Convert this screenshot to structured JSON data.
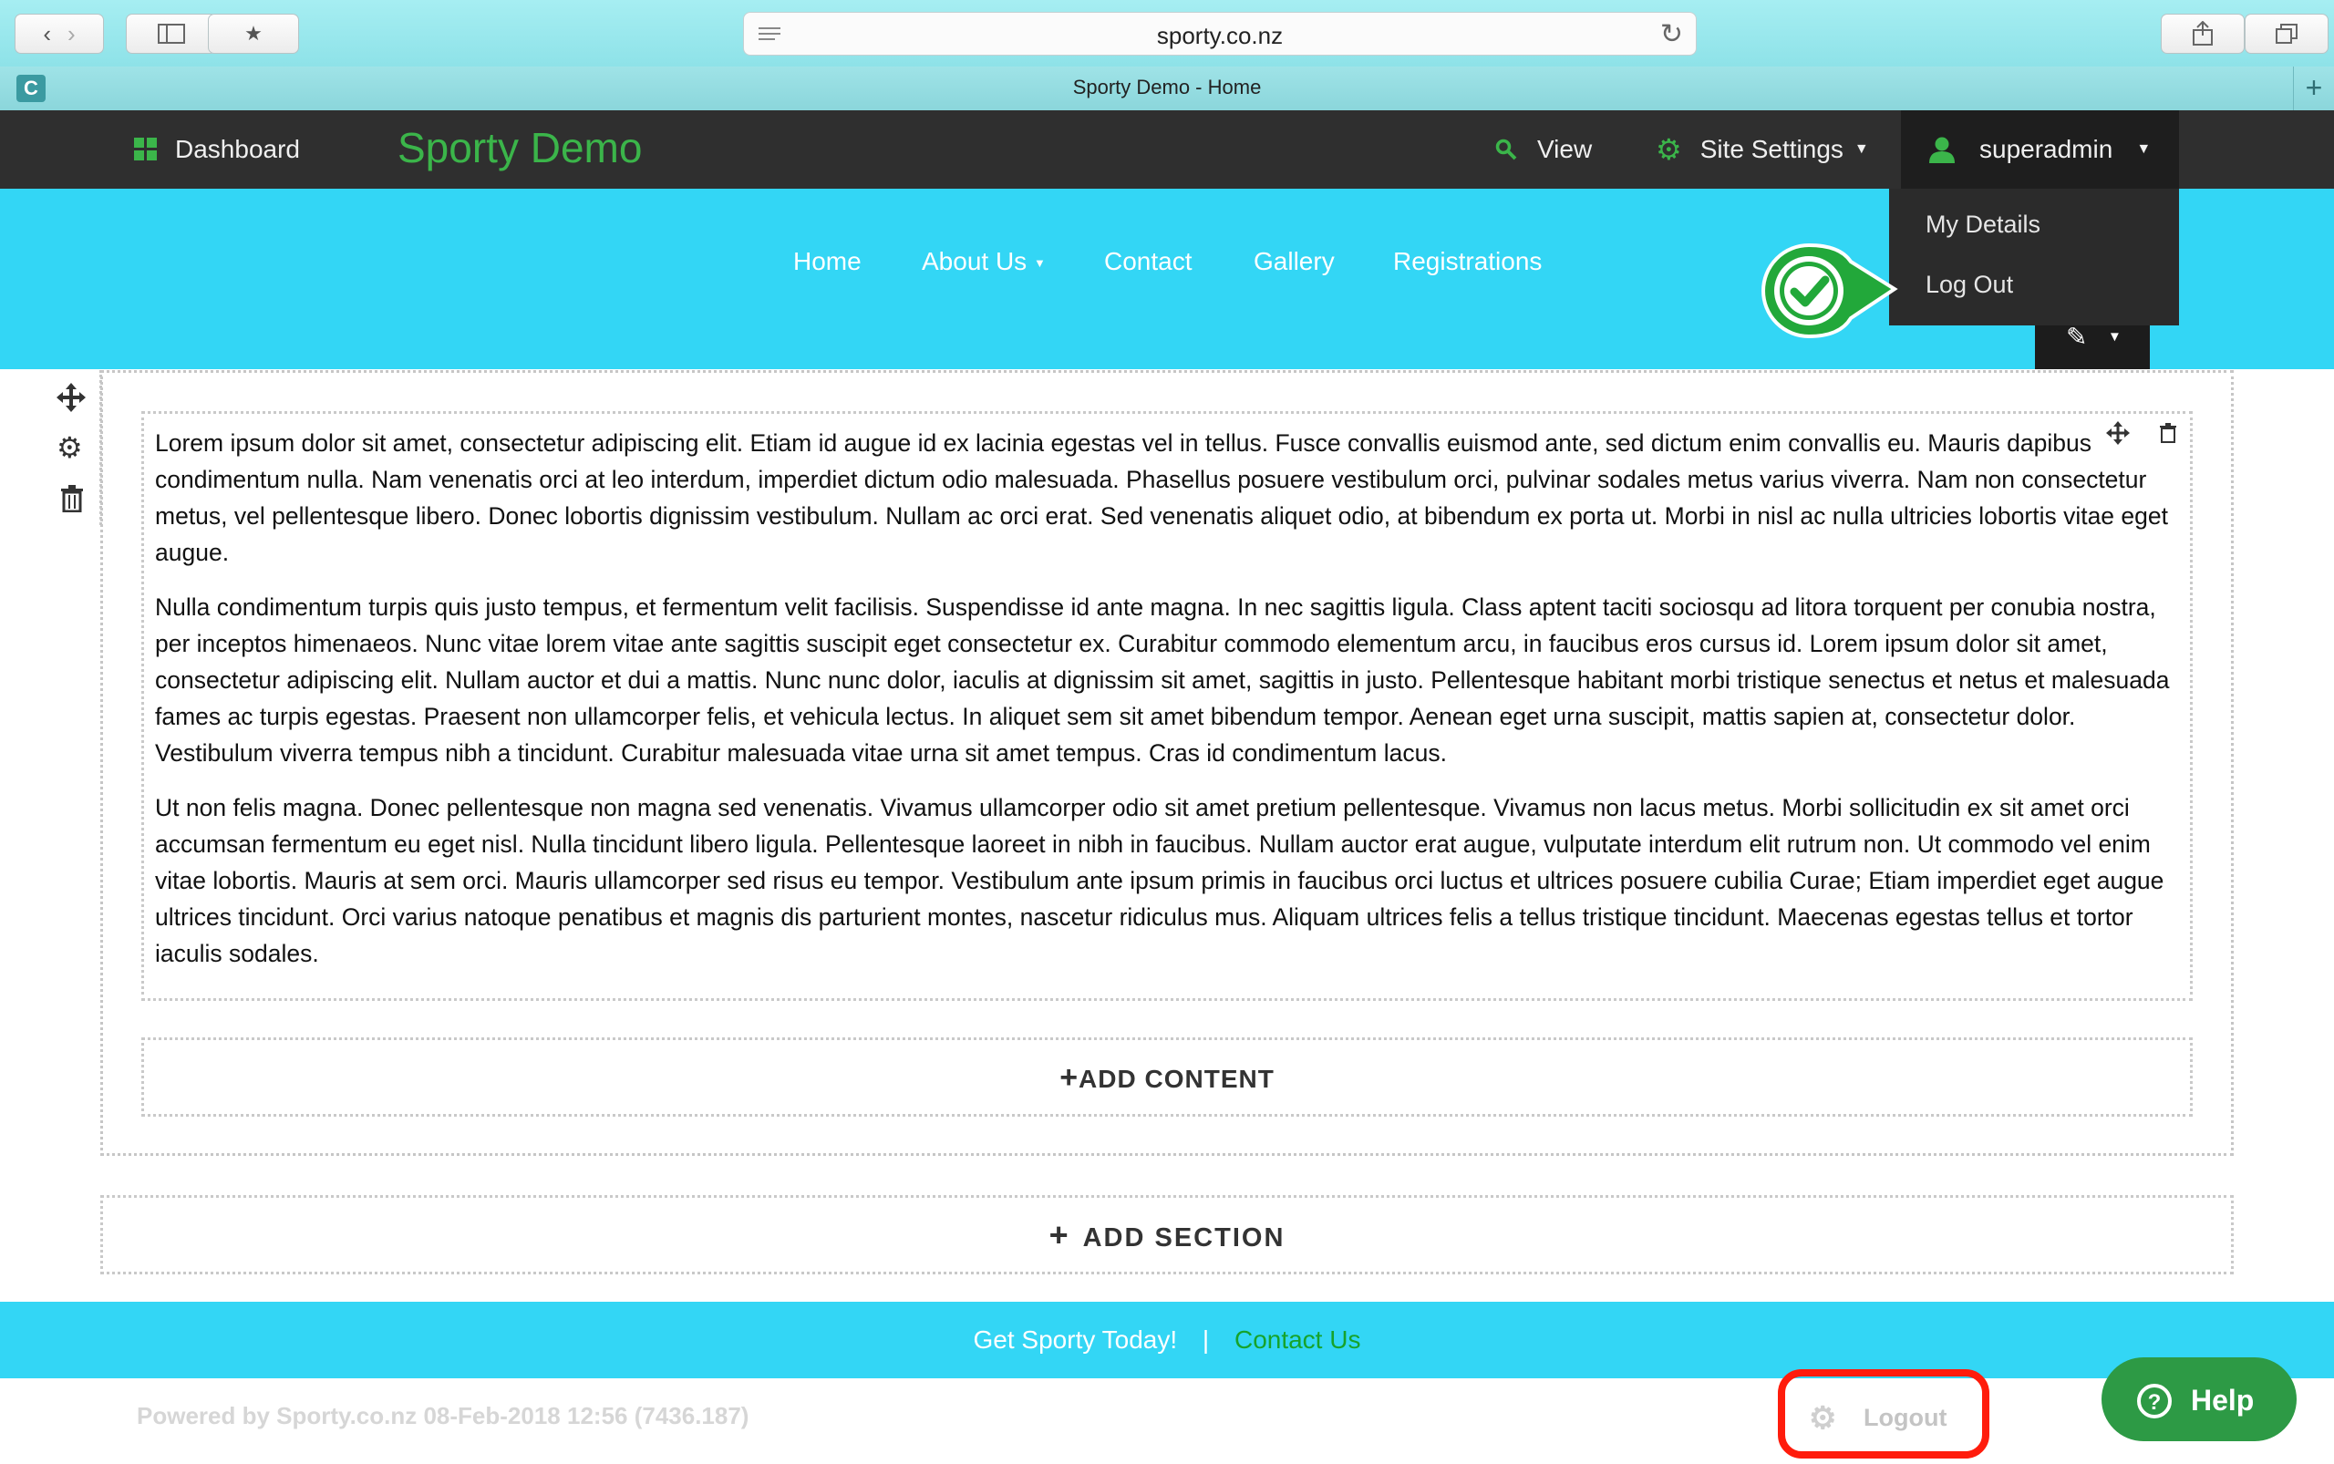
{
  "browser": {
    "url": "sporty.co.nz",
    "tab_title": "Sporty Demo - Home",
    "tab_icon_letter": "C"
  },
  "admin_bar": {
    "dashboard_label": "Dashboard",
    "brand": "Sporty Demo",
    "view_label": "View",
    "site_settings_label": "Site Settings",
    "user_label": "superadmin",
    "dropdown": [
      "My Details",
      "Log Out"
    ]
  },
  "site_nav": {
    "items": [
      {
        "label": "Home"
      },
      {
        "label": "About Us"
      },
      {
        "label": "Contact"
      },
      {
        "label": "Gallery"
      },
      {
        "label": "Registrations"
      }
    ]
  },
  "content": {
    "paragraphs": [
      "Lorem ipsum dolor sit amet, consectetur adipiscing elit. Etiam id augue id ex lacinia egestas vel in tellus. Fusce convallis euismod ante, sed dictum enim convallis eu. Mauris dapibus condimentum nulla. Nam venenatis orci at leo interdum, imperdiet dictum odio malesuada. Phasellus posuere vestibulum orci, pulvinar sodales metus varius viverra. Nam non consectetur metus, vel pellentesque libero. Donec lobortis dignissim vestibulum. Nullam ac orci erat. Sed venenatis aliquet odio, at bibendum ex porta ut. Morbi in nisl ac nulla ultricies lobortis vitae eget augue.",
      "Nulla condimentum turpis quis justo tempus, et fermentum velit facilisis. Suspendisse id ante magna. In nec sagittis ligula. Class aptent taciti sociosqu ad litora torquent per conubia nostra, per inceptos himenaeos. Nunc vitae lorem vitae ante sagittis suscipit eget consectetur ex. Curabitur commodo elementum arcu, in faucibus eros cursus id. Lorem ipsum dolor sit amet, consectetur adipiscing elit. Nullam auctor et dui a mattis. Nunc nunc dolor, iaculis at dignissim sit amet, sagittis in justo. Pellentesque habitant morbi tristique senectus et netus et malesuada fames ac turpis egestas. Praesent non ullamcorper felis, et vehicula lectus. In aliquet sem sit amet bibendum tempor. Aenean eget urna suscipit, mattis sapien at, consectetur dolor. Vestibulum viverra tempus nibh a tincidunt. Curabitur malesuada vitae urna sit amet tempus. Cras id condimentum lacus.",
      "Ut non felis magna. Donec pellentesque non magna sed venenatis. Vivamus ullamcorper odio sit amet pretium pellentesque. Vivamus non lacus metus. Morbi sollicitudin ex sit amet orci accumsan fermentum eu eget nisl. Nulla tincidunt libero ligula. Pellentesque laoreet in nibh in faucibus. Nullam auctor erat augue, vulputate interdum elit rutrum non. Ut commodo vel enim vitae lobortis. Mauris at sem orci. Mauris ullamcorper sed risus eu tempor. Vestibulum ante ipsum primis in faucibus orci luctus et ultrices posuere cubilia Curae; Etiam imperdiet eget augue ultrices tincidunt. Orci varius natoque penatibus et magnis dis parturient montes, nascetur ridiculus mus. Aliquam ultrices felis a tellus tristique tincidunt. Maecenas egestas tellus et tortor iaculis sodales."
    ],
    "add_content_label": "ADD CONTENT",
    "add_section_label": "ADD SECTION"
  },
  "footer": {
    "tagline": "Get Sporty Today!",
    "separator": "|",
    "contact_label": "Contact Us",
    "powered_by": "Powered by Sporty.co.nz 08-Feb-2018 12:56 (7436.187)",
    "logout_label": "Logout",
    "help_label": "Help"
  },
  "colors": {
    "brand_green": "#3bb54a",
    "header_cyan": "#33d6f5",
    "admin_dark": "#2f2f2f",
    "annotation_red": "#ff1c0c",
    "help_green": "#2d9a45"
  },
  "icons": [
    "dashboard-grid-icon",
    "search-icon",
    "gear-icon",
    "user-icon",
    "caret-down-icon",
    "move-icon",
    "trash-icon",
    "pencil-icon",
    "checkmark-icon",
    "plus-icon",
    "question-icon",
    "back-icon",
    "forward-icon",
    "sidebar-icon",
    "bookmark-icon",
    "reader-icon",
    "reload-icon",
    "share-icon",
    "tabs-icon"
  ]
}
